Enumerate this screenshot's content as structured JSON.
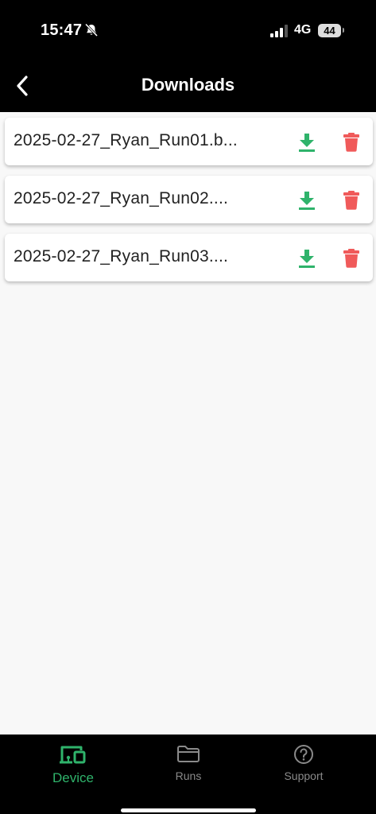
{
  "status_bar": {
    "time": "15:47",
    "network": "4G",
    "battery": "44",
    "icons": [
      "bell-muted-icon",
      "signal-icon"
    ]
  },
  "header": {
    "title": "Downloads",
    "back_icon": "chevron-left-icon"
  },
  "files": [
    {
      "name": "2025-02-27_Ryan_Run01.b...",
      "download_icon": "download-icon",
      "delete_icon": "trash-icon"
    },
    {
      "name": "2025-02-27_Ryan_Run02....",
      "download_icon": "download-icon",
      "delete_icon": "trash-icon"
    },
    {
      "name": "2025-02-27_Ryan_Run03....",
      "download_icon": "download-icon",
      "delete_icon": "trash-icon"
    }
  ],
  "tabbar": {
    "tabs": [
      {
        "label": "Device",
        "icon": "devices-icon",
        "active": true
      },
      {
        "label": "Runs",
        "icon": "folder-icon",
        "active": false
      },
      {
        "label": "Support",
        "icon": "help-circle-icon",
        "active": false
      }
    ]
  },
  "colors": {
    "accent": "#2fb36b",
    "delete": "#f05a5a",
    "header_bg": "#000000",
    "page_bg": "#f8f8f8"
  }
}
